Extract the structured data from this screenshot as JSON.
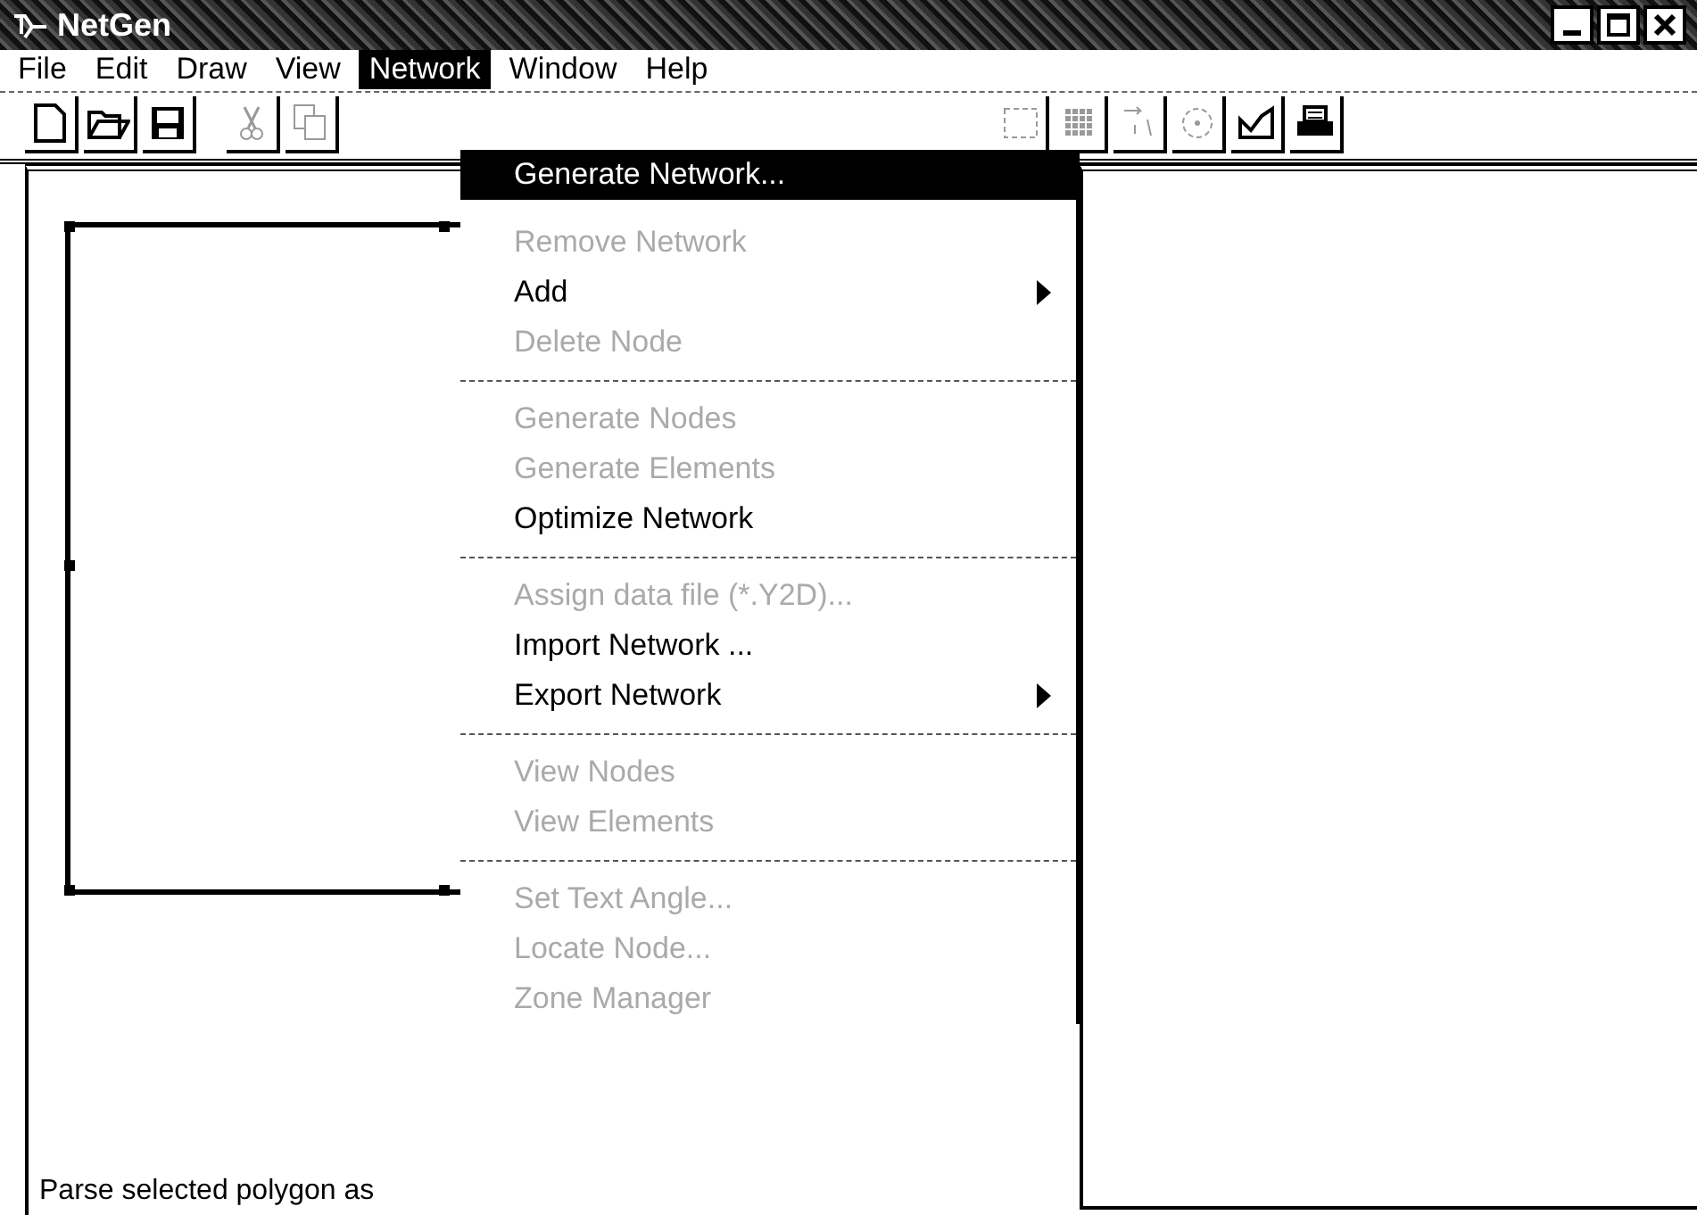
{
  "window": {
    "title": "NetGen"
  },
  "menu_bar": [
    {
      "label": "File",
      "selected": false
    },
    {
      "label": "Edit",
      "selected": false
    },
    {
      "label": "Draw",
      "selected": false
    },
    {
      "label": "View",
      "selected": false
    },
    {
      "label": "Network",
      "selected": true
    },
    {
      "label": "Window",
      "selected": false
    },
    {
      "label": "Help",
      "selected": false
    }
  ],
  "toolbar": [
    {
      "kind": "new",
      "disabled": false
    },
    {
      "kind": "open",
      "disabled": false
    },
    {
      "kind": "save",
      "disabled": false
    },
    {
      "kind": "cut",
      "disabled": true
    },
    {
      "kind": "copy",
      "disabled": true
    },
    {
      "kind": "select",
      "disabled": true
    },
    {
      "kind": "grid",
      "disabled": true
    },
    {
      "kind": "arrows",
      "disabled": true
    },
    {
      "kind": "circle",
      "disabled": true
    },
    {
      "kind": "mesh",
      "disabled": false
    },
    {
      "kind": "print",
      "disabled": false
    }
  ],
  "network_menu": [
    {
      "kind": "item",
      "label": "Generate Network...",
      "selected": true,
      "disabled": false,
      "submenu": false
    },
    {
      "kind": "item",
      "label": "Remove Network",
      "selected": false,
      "disabled": true,
      "submenu": false
    },
    {
      "kind": "item",
      "label": "Add",
      "selected": false,
      "disabled": false,
      "submenu": true
    },
    {
      "kind": "item",
      "label": "Delete Node",
      "selected": false,
      "disabled": true,
      "submenu": false
    },
    {
      "kind": "separator"
    },
    {
      "kind": "item",
      "label": "Generate Nodes",
      "selected": false,
      "disabled": true,
      "submenu": false
    },
    {
      "kind": "item",
      "label": "Generate Elements",
      "selected": false,
      "disabled": true,
      "submenu": false
    },
    {
      "kind": "item",
      "label": "Optimize Network",
      "selected": false,
      "disabled": false,
      "submenu": false
    },
    {
      "kind": "separator"
    },
    {
      "kind": "item",
      "label": "Assign data file (*.Y2D)...",
      "selected": false,
      "disabled": true,
      "submenu": false
    },
    {
      "kind": "item",
      "label": "Import Network ...",
      "selected": false,
      "disabled": false,
      "submenu": false
    },
    {
      "kind": "item",
      "label": "Export Network",
      "selected": false,
      "disabled": false,
      "submenu": true
    },
    {
      "kind": "separator"
    },
    {
      "kind": "item",
      "label": "View Nodes",
      "selected": false,
      "disabled": true,
      "submenu": false
    },
    {
      "kind": "item",
      "label": "View Elements",
      "selected": false,
      "disabled": true,
      "submenu": false
    },
    {
      "kind": "separator"
    },
    {
      "kind": "item",
      "label": "Set Text Angle...",
      "selected": false,
      "disabled": true,
      "submenu": false
    },
    {
      "kind": "item",
      "label": "Locate Node...",
      "selected": false,
      "disabled": true,
      "submenu": false
    },
    {
      "kind": "item",
      "label": "Zone Manager",
      "selected": false,
      "disabled": true,
      "submenu": false
    }
  ],
  "status_bar": {
    "text": "Parse selected polygon as"
  }
}
